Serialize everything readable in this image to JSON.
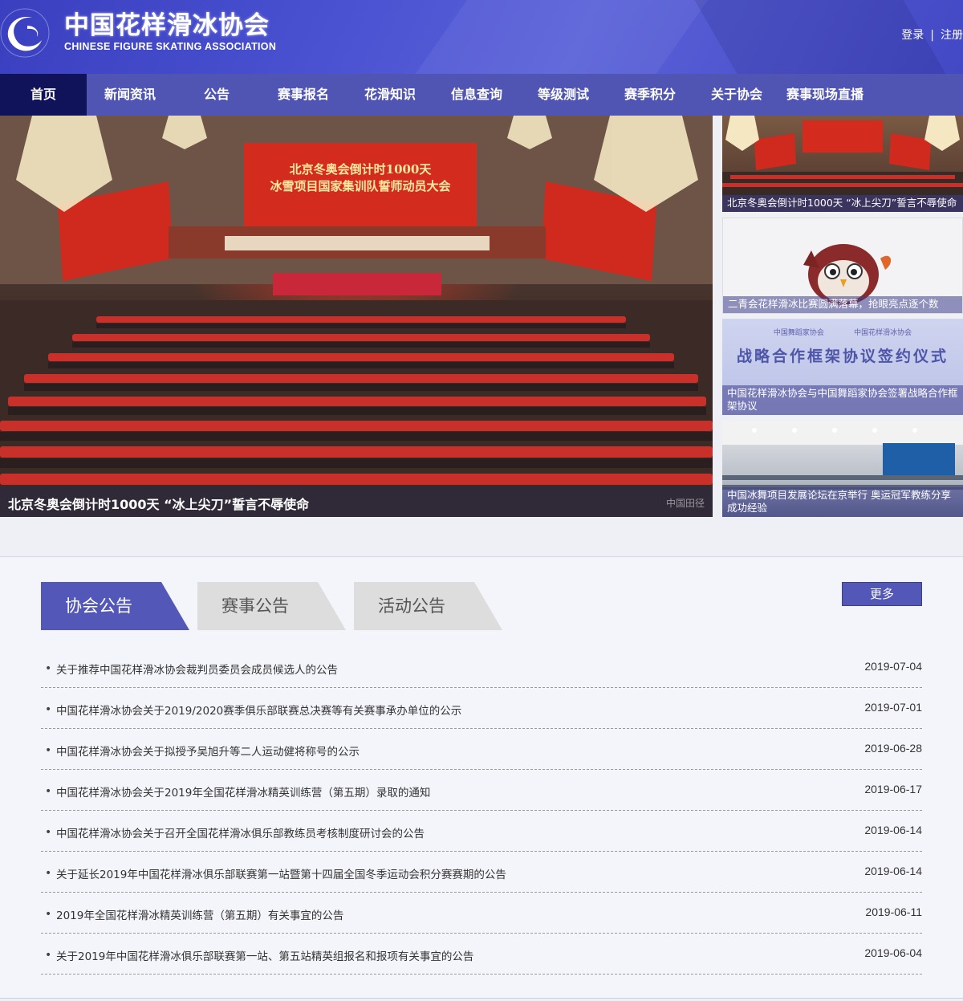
{
  "header": {
    "title_cn": "中国花样滑冰协会",
    "title_en": "CHINESE FIGURE SKATING ASSOCIATION",
    "login": "登录",
    "separator": "|",
    "register": "注册"
  },
  "nav": {
    "items": [
      {
        "label": "首页"
      },
      {
        "label": "新闻资讯"
      },
      {
        "label": "公告"
      },
      {
        "label": "赛事报名"
      },
      {
        "label": "花滑知识"
      },
      {
        "label": "信息查询"
      },
      {
        "label": "等级测试"
      },
      {
        "label": "赛季积分"
      },
      {
        "label": "关于协会"
      },
      {
        "label": "赛事现场直播"
      }
    ]
  },
  "hero": {
    "caption": "北京冬奥会倒计时1000天 “冰上尖刀”誓言不辱使命",
    "watermark": "中国田径",
    "screen_line1": "北京冬奥会倒计时1000天",
    "screen_line2": "冰雪项目国家集训队誓师动员大会"
  },
  "thumbs": [
    {
      "caption": "北京冬奥会倒计时1000天 “冰上尖刀”誓言不辱使命"
    },
    {
      "caption": "二青会花样滑冰比赛圆满落幕，抢眼亮点逐个数"
    },
    {
      "caption": "中国花样滑冰协会与中国舞蹈家协会签署战略合作框架协议",
      "banner_small_left": "中国舞蹈家协会",
      "banner_small_right": "中国花样滑冰协会",
      "banner_title": "战略合作框架协议签约仪式"
    },
    {
      "caption": "中国冰舞项目发展论坛在京举行 奥运冠军教练分享成功经验"
    }
  ],
  "notices": {
    "tabs": [
      {
        "label": "协会公告"
      },
      {
        "label": "赛事公告"
      },
      {
        "label": "活动公告"
      }
    ],
    "more": "更多",
    "bullet": "•",
    "items": [
      {
        "title": "关于推荐中国花样滑冰协会裁判员委员会成员候选人的公告",
        "date": "2019-07-04"
      },
      {
        "title": "中国花样滑冰协会关于2019/2020赛季俱乐部联赛总决赛等有关赛事承办单位的公示",
        "date": "2019-07-01"
      },
      {
        "title": "中国花样滑冰协会关于拟授予吴旭升等二人运动健将称号的公示",
        "date": "2019-06-28"
      },
      {
        "title": "中国花样滑冰协会关于2019年全国花样滑冰精英训练营（第五期）录取的通知",
        "date": "2019-06-17"
      },
      {
        "title": "中国花样滑冰协会关于召开全国花样滑冰俱乐部教练员考核制度研讨会的公告",
        "date": "2019-06-14"
      },
      {
        "title": "关于延长2019年中国花样滑冰俱乐部联赛第一站暨第十四届全国冬季运动会积分赛赛期的公告",
        "date": "2019-06-14"
      },
      {
        "title": "2019年全国花样滑冰精英训练营（第五期）有关事宜的公告",
        "date": "2019-06-11"
      },
      {
        "title": "关于2019年中国花样滑冰俱乐部联赛第一站、第五站精英组报名和报项有关事宜的公告",
        "date": "2019-06-04"
      }
    ]
  },
  "colors": {
    "header_blue": "#4a52d2",
    "nav_blue": "#5055b3",
    "nav_active": "#10125a",
    "tab_active": "#5257b8",
    "tab_inactive": "#dddddd"
  }
}
